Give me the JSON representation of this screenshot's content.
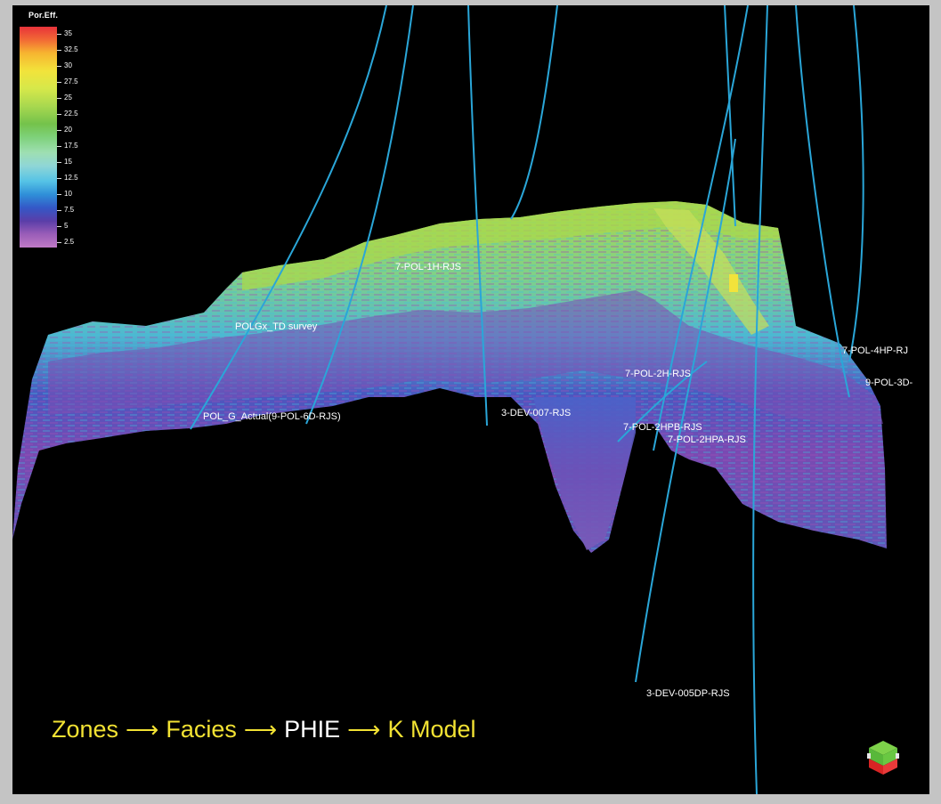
{
  "legend": {
    "title": "Por.Eff.",
    "ticks": [
      "35",
      "32.5",
      "30",
      "27.5",
      "25",
      "22.5",
      "20",
      "17.5",
      "15",
      "12.5",
      "10",
      "7.5",
      "5",
      "2.5"
    ]
  },
  "wells": [
    {
      "label": "7-POL-1H-RJS"
    },
    {
      "label": "POLGx_TD survey"
    },
    {
      "label": "POL_G_Actual(9-POL-6D-RJS)"
    },
    {
      "label": "3-DEV-007-RJS"
    },
    {
      "label": "7-POL-2H-RJS"
    },
    {
      "label": "7-POL-2HPB-RJS"
    },
    {
      "label": "7-POL-2HPA-RJS"
    },
    {
      "label": "7-POL-4HP-RJ"
    },
    {
      "label": "9-POL-3D-"
    },
    {
      "label": "3-DEV-005DP-RJS"
    }
  ],
  "workflow": {
    "step1": "Zones",
    "step2": "Facies",
    "step3": "PHIE",
    "step4": "K Model",
    "arrow": "⟶"
  },
  "colors": {
    "well_trajectory": "#2aa6d8",
    "workflow_text": "#f2e233",
    "background": "#000000"
  }
}
